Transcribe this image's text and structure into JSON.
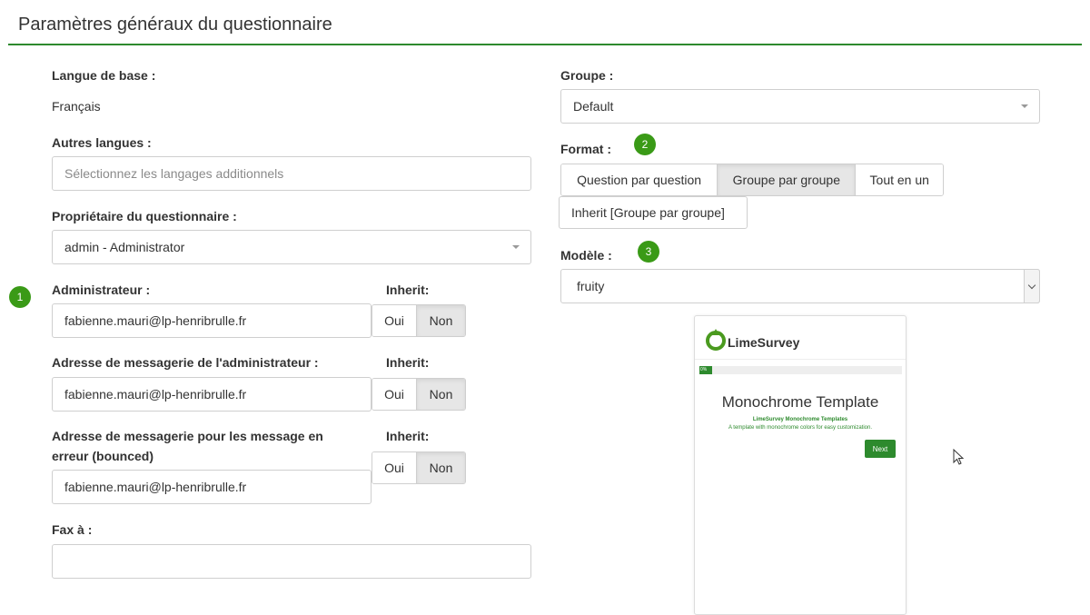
{
  "page": {
    "title": "Paramètres généraux du questionnaire"
  },
  "left": {
    "base_language_label": "Langue de base :",
    "base_language_value": "Français",
    "other_languages_label": "Autres langues :",
    "other_languages_placeholder": "Sélectionnez les langages additionnels",
    "owner_label": "Propriétaire du questionnaire :",
    "owner_value": "admin - Administrator",
    "admin_label": "Administrateur :",
    "admin_value": "fabienne.mauri@lp-henribrulle.fr",
    "admin_email_label": "Adresse de messagerie de l'administrateur :",
    "admin_email_value": "fabienne.mauri@lp-henribrulle.fr",
    "bounce_label_line1": "Adresse de messagerie pour les message en",
    "bounce_label_line2": "erreur (bounced)",
    "bounce_value": "fabienne.mauri@lp-henribrulle.fr",
    "fax_label": "Fax à :",
    "fax_value": "",
    "inherit_label": "Inherit:",
    "yes_label": "Oui",
    "no_label": "Non"
  },
  "right": {
    "group_label": "Groupe :",
    "group_value": "Default",
    "format_label": "Format :",
    "format_options": [
      "Question par question",
      "Groupe par groupe",
      "Tout en un"
    ],
    "format_selected": "Groupe par groupe",
    "format_inherit": "Inherit [Groupe par groupe]",
    "template_label": "Modèle :",
    "template_value": "fruity"
  },
  "badges": {
    "one": "1",
    "two": "2",
    "three": "3"
  },
  "preview": {
    "logo_text": "LimeSurvey",
    "progress_text": "0%",
    "title": "Monochrome Template",
    "subtitle": "LimeSurvey Monochrome Templates",
    "description": "A template with monochrome colors for easy customization.",
    "next_label": "Next"
  },
  "colors": {
    "accent": "#2d8a2d",
    "badge": "#3a9a17"
  },
  "icons": {
    "select_caret": "caret-down-icon",
    "logo": "limesurvey-logo-icon",
    "cursor": "mouse-pointer-icon"
  }
}
